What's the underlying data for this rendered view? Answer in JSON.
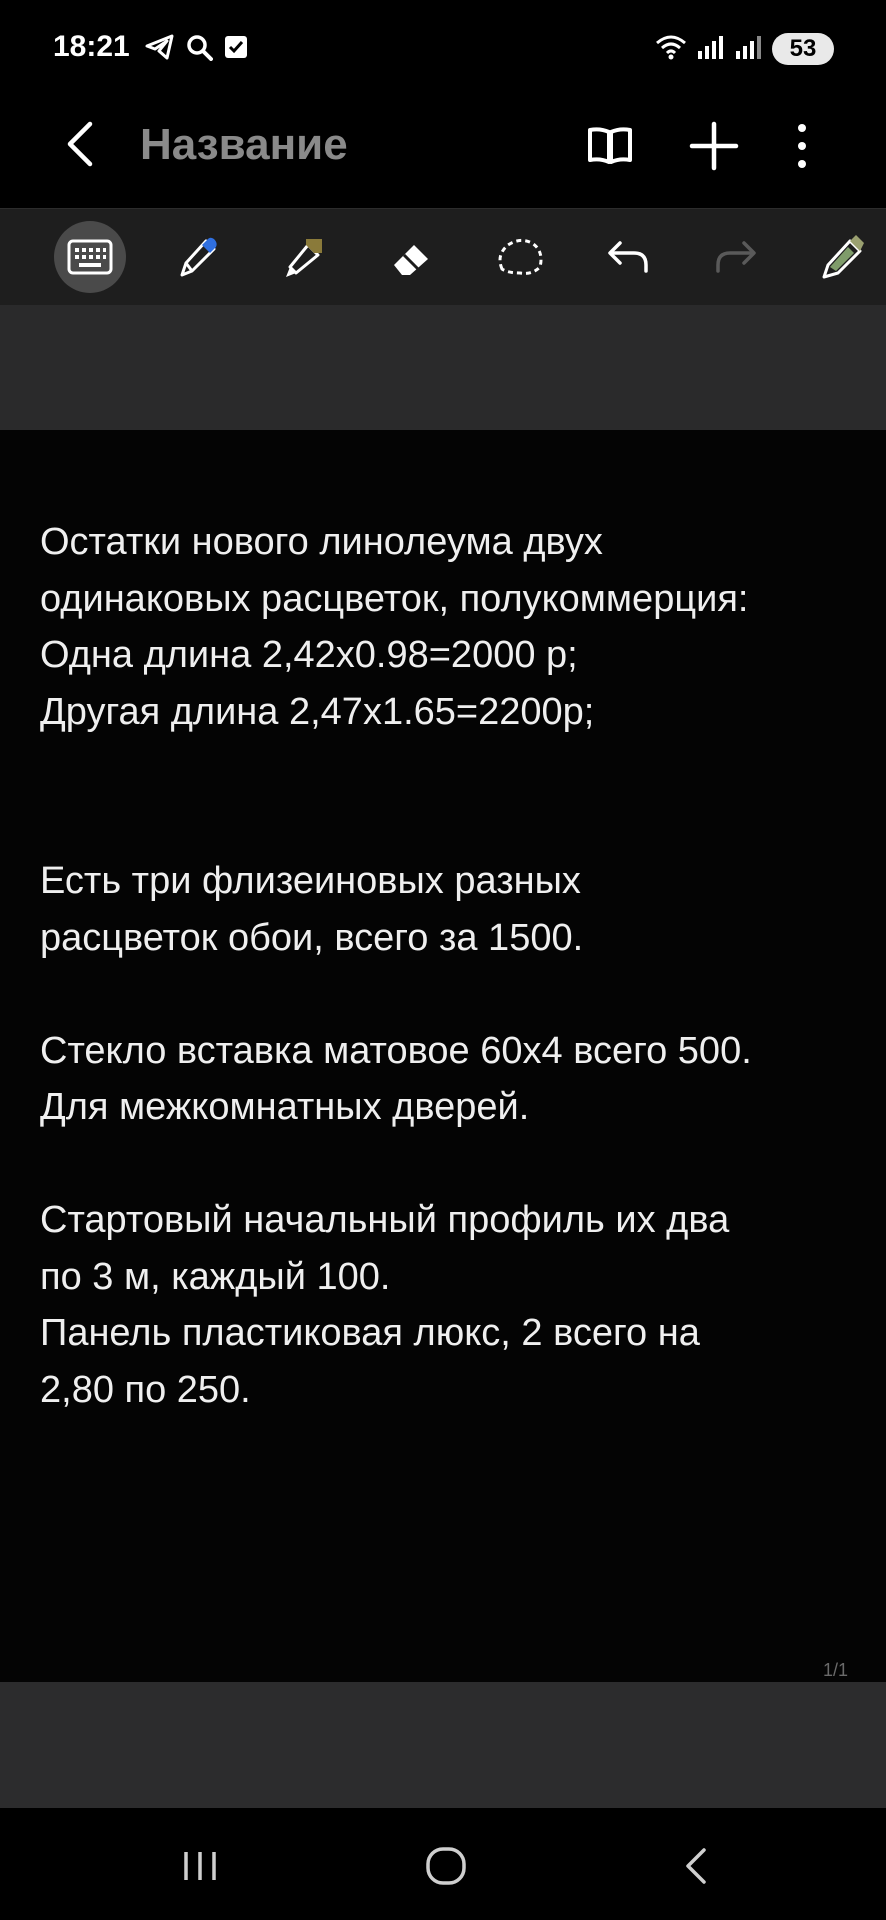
{
  "status_bar": {
    "time": "18:21",
    "left_icons": [
      "telegram-icon",
      "search-icon",
      "checkbox-icon"
    ],
    "right_icons": [
      "wifi-icon",
      "signal-icon",
      "signal-icon"
    ],
    "battery": "53"
  },
  "app_bar": {
    "title": "Название",
    "actions": [
      "book-icon",
      "plus-icon",
      "more-vert-icon"
    ]
  },
  "toolbar": {
    "tools": [
      "keyboard",
      "pen",
      "highlighter",
      "eraser",
      "lasso",
      "undo",
      "redo",
      "pen-settings"
    ],
    "active_tool": "keyboard"
  },
  "note": {
    "lines": [
      "Остатки нового линолеума двух",
      "одинаковых расцветок, полукоммерция:",
      "Одна длина 2,42х0.98=2000 р;",
      "Другая длина 2,47х1.65=2200р;",
      "",
      "",
      "Есть три флизеиновых разных",
      "расцветок обои, всего за 1500.",
      "",
      "Стекло вставка матовое 60х4 всего 500.",
      "Для межкомнатных дверей.",
      "",
      "Стартовый начальный профиль их два",
      "по 3 м, каждый 100.",
      "Панель пластиковая люкс, 2 всего на",
      "2,80 по 250."
    ],
    "page_indicator": "1/1"
  },
  "nav_bar": {
    "buttons": [
      "recent-apps",
      "home",
      "back"
    ]
  },
  "colors": {
    "background": "#000000",
    "toolbar": "#1e1e1e",
    "band": "#2a2a2b",
    "text": "#efefef",
    "title": "#8a8a8a",
    "pen_accent": "#2f6fe0",
    "highlighter_accent": "#8a7a3a"
  }
}
